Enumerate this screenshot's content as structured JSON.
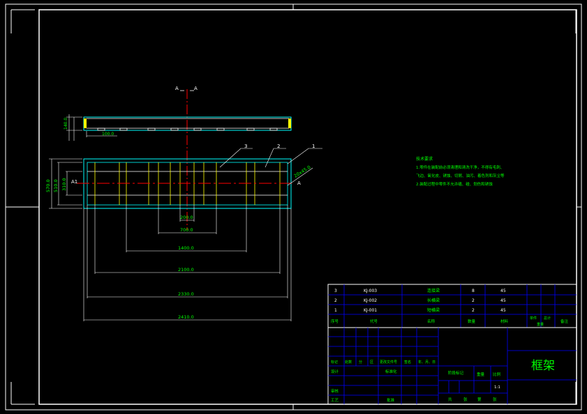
{
  "colors": {
    "background": "#000000",
    "border": "#ffffff",
    "outline": "#00ffff",
    "hidden": "#ffff00",
    "center": "#ff0000",
    "text": "#00ff00",
    "table": "#0000ff"
  },
  "section": {
    "left_label": "A",
    "right_label": "A",
    "arrow_left": "A1",
    "arrow_right": "A"
  },
  "dims": {
    "top_height": "140.0",
    "top_tab": "100.0",
    "total_height": "570.0",
    "inner_height": "510.0",
    "center_height": "310.0",
    "slot_width": "200.0",
    "d_700": "700.0",
    "d_1400": "1400.0",
    "d_2100": "2100.0",
    "d_2330": "2330.0",
    "d_2410": "2410.0",
    "chamfer": "20x45.0"
  },
  "callouts": [
    "3",
    "2",
    "1"
  ],
  "notes": {
    "title": "技术要求",
    "line1": "1.零件在装配前必须清理和清洗干净，不得有毛刺、",
    "line2": "飞边、氧化皮、锈蚀、切屑、油污、着色剂和灰尘等",
    "line3": "2.装配过程中零件不允许磕、碰、划伤和锈蚀"
  },
  "parts_rows": [
    {
      "no": "3",
      "code": "KJ-003",
      "name": "连接梁",
      "qty": "8",
      "mat": "45"
    },
    {
      "no": "2",
      "code": "KJ-002",
      "name": "长横梁",
      "qty": "2",
      "mat": "45"
    },
    {
      "no": "1",
      "code": "KJ-001",
      "name": "短横梁",
      "qty": "2",
      "mat": "45"
    }
  ],
  "parts_header": {
    "no": "序号",
    "code": "代号",
    "name": "名称",
    "qty": "数量",
    "mat": "材料",
    "unit": "单件",
    "total": "总计",
    "weight": "重量",
    "remark": "备注"
  },
  "title_block": {
    "drawing_title": "框架",
    "revision_row": [
      "标记",
      "处数",
      "分",
      "区",
      "更改文件号",
      "签名",
      "年、月、日"
    ],
    "designer": "设计",
    "standard": "标准化",
    "checker": "审核",
    "process": "工艺",
    "approve": "批准",
    "stage_mark": "阶段标记",
    "weight": "重量",
    "scale": "比例",
    "scale_value": "1:1",
    "sheets": "共",
    "sheet_of": "张",
    "sheet_no": "第",
    "sheet_unit": "张"
  }
}
